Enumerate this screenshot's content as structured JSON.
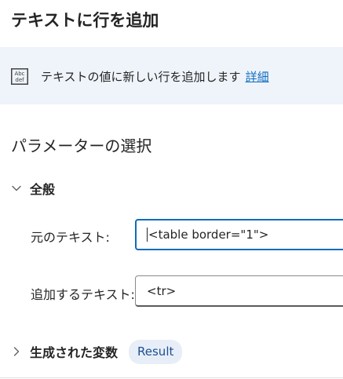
{
  "dialog": {
    "title": "テキストに行を追加"
  },
  "info": {
    "icon": "abc-def-icon",
    "text": "テキストの値に新しい行を追加します",
    "link": "詳細"
  },
  "parameters": {
    "section_title": "パラメーターの選択",
    "general": {
      "label": "全般",
      "expanded": true,
      "fields": [
        {
          "label": "元のテキスト:",
          "value": "<table border=\"1\">",
          "focused": true
        },
        {
          "label": "追加するテキスト:",
          "value": "<tr>",
          "focused": false
        }
      ]
    }
  },
  "variables": {
    "label": "生成された変数",
    "expanded": false,
    "pill": "Result"
  },
  "colors": {
    "accent": "#0f6cbd",
    "banner_bg": "#eff4fb",
    "pill_bg": "#e8eef8"
  }
}
